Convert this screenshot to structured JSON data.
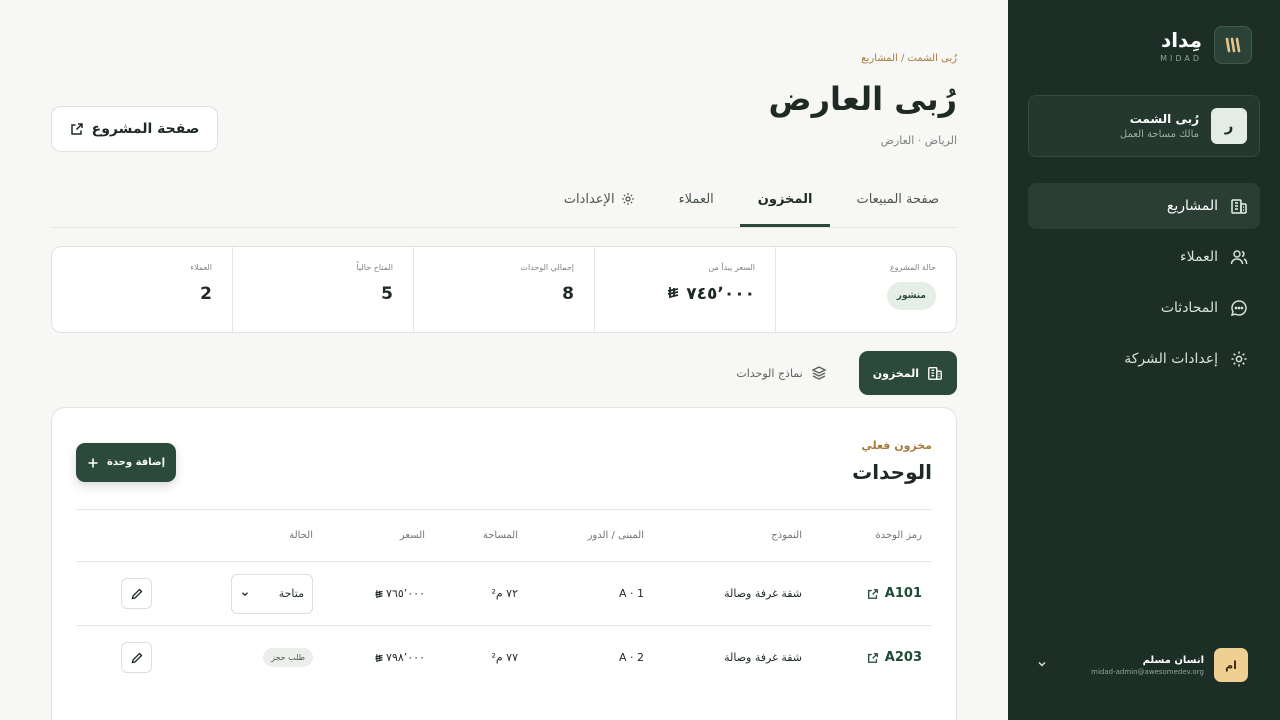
{
  "sidebar": {
    "brand_name": "مِداد",
    "brand_sub": "MIDAD",
    "workspace": {
      "avatar": "ر",
      "name": "رُبى الشمت",
      "role": "مالك مساحة العمل"
    },
    "nav": [
      {
        "label": "المشاريع",
        "icon": "building-icon",
        "active": true
      },
      {
        "label": "العملاء",
        "icon": "users-icon"
      },
      {
        "label": "المحادثات",
        "icon": "chat-icon"
      },
      {
        "label": "إعدادات الشركة",
        "icon": "gear-icon"
      }
    ],
    "user": {
      "avatar": "ام",
      "name": "انسان مسلم",
      "email": "midad-admin@awesomedev.org"
    }
  },
  "header": {
    "breadcrumb": "رُبى الشمت / المشاريع",
    "title": "رُبى العارض",
    "subtitle": "الرياض · العارض",
    "project_button": "صفحة المشروع"
  },
  "tabs": [
    {
      "label": "صفحة المبيعات"
    },
    {
      "label": "المخزون",
      "active": true
    },
    {
      "label": "العملاء"
    },
    {
      "label": "الإعدادات"
    }
  ],
  "stats": {
    "status_label": "حالة المشروع",
    "status_value": "منشور",
    "price_label": "السعر يبدأ من",
    "price_value": "٧٤٥٬٠٠٠",
    "units_label": "إجمالي الوحدات",
    "units_value": "8",
    "available_label": "المتاح حالياً",
    "available_value": "5",
    "clients_label": "العملاء",
    "clients_value": "2"
  },
  "subtabs": [
    {
      "label": "المخزون",
      "active": true
    },
    {
      "label": "نماذج الوحدات"
    }
  ],
  "card": {
    "kicker": "مخزون فعلي",
    "title": "الوحدات",
    "add_button": "إضافة وحدة"
  },
  "table": {
    "columns": [
      "رمز الوحدة",
      "النموذج",
      "المبنى / الدور",
      "المساحة",
      "السعر",
      "الحالة"
    ],
    "rows": [
      {
        "code": "A101",
        "model": "شقة غرفة وصالة",
        "floor": "A · 1",
        "area": "٧٢ م²",
        "price": "٧٦٥٬٠٠٠",
        "status": "متاحة",
        "status_type": "select"
      },
      {
        "code": "A203",
        "model": "شقة غرفة وصالة",
        "floor": "A · 2",
        "area": "٧٧ م²",
        "price": "٧٩٨٬٠٠٠",
        "status": "طلب حجز",
        "status_type": "badge"
      }
    ]
  }
}
